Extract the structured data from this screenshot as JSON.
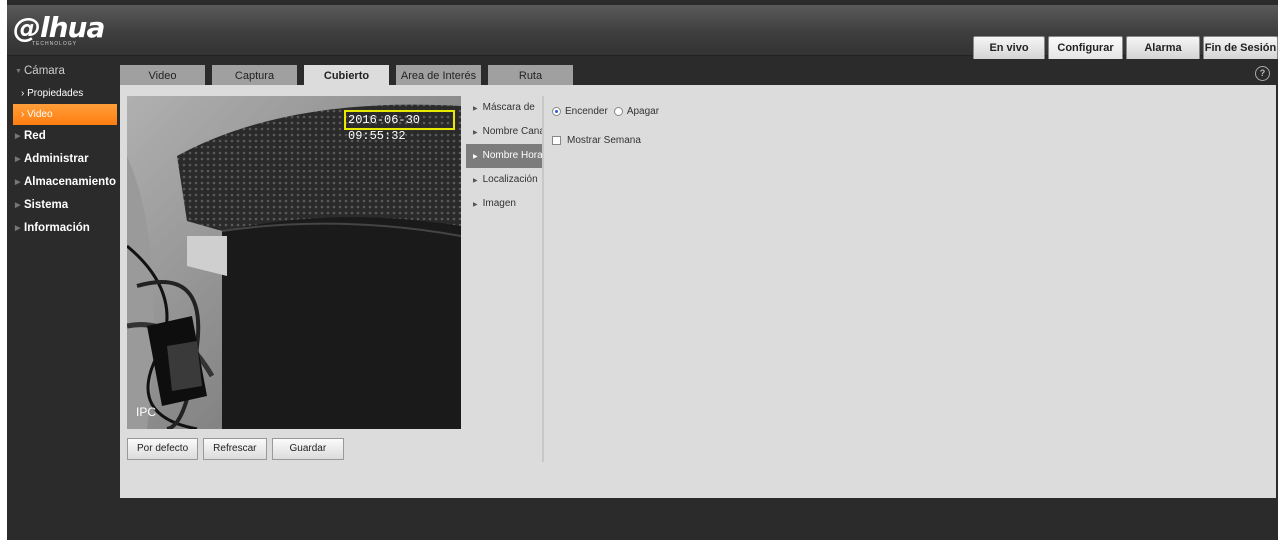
{
  "brand": {
    "logo": "@lhua",
    "tagline": "TECHNOLOGY"
  },
  "topnav": [
    {
      "label": "En vivo",
      "w": 70
    },
    {
      "label": "Configurar",
      "w": 73,
      "active": true
    },
    {
      "label": "Alarma",
      "w": 72
    },
    {
      "label": "Fin de Sesión",
      "w": 73
    }
  ],
  "sidebar": {
    "camera_group": "Cámara",
    "camera_items": [
      "Propiedades",
      "Video"
    ],
    "groups": [
      "Red",
      "Administrar",
      "Almacenamiento",
      "Sistema",
      "Información"
    ]
  },
  "tabs": [
    "Video",
    "Captura",
    "Cubierto",
    "Area de Interés",
    "Ruta"
  ],
  "active_tab": "Cubierto",
  "video": {
    "osd_time": "2016-06-30 09:55:32",
    "osd_overlay": "Nombre Canal",
    "channel_label": "IPC"
  },
  "buttons": {
    "default": "Por defecto",
    "refresh": "Refrescar",
    "save": "Guardar"
  },
  "subnav": [
    "Máscara de",
    "Nombre Canal",
    "Nombre Horario",
    "Localización",
    "Imagen"
  ],
  "active_subnav": "Nombre Horario",
  "settings": {
    "on_label": "Encender",
    "off_label": "Apagar",
    "enabled": true,
    "show_week_label": "Mostrar Semana",
    "show_week": false
  },
  "colors": {
    "accent": "#ff8c1f",
    "header": "#4a4a4a",
    "panel": "#dcdcdc",
    "osd_box": "#e8e800"
  }
}
